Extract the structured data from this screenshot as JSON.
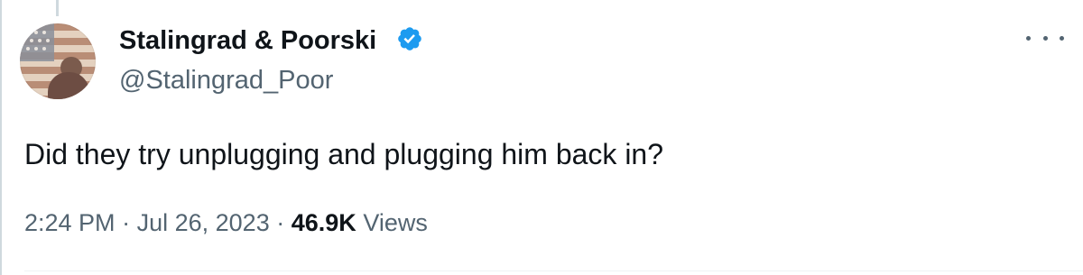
{
  "tweet": {
    "author": {
      "display_name": "Stalingrad & Poorski",
      "handle": "@Stalingrad_Poor",
      "verified_icon": "verified-badge-icon",
      "avatar_icon": "profile-avatar"
    },
    "text": "Did they try unplugging and plugging him back in?",
    "meta": {
      "time": "2:24 PM",
      "separator_1": "·",
      "date": "Jul 26, 2023",
      "separator_2": "·",
      "views_count": "46.9K",
      "views_label": "Views"
    },
    "menu_icon": "more-options-icon"
  },
  "colors": {
    "text_primary": "#0f1419",
    "text_secondary": "#536471",
    "verified": "#1d9bf0",
    "border": "#cfd9de"
  }
}
